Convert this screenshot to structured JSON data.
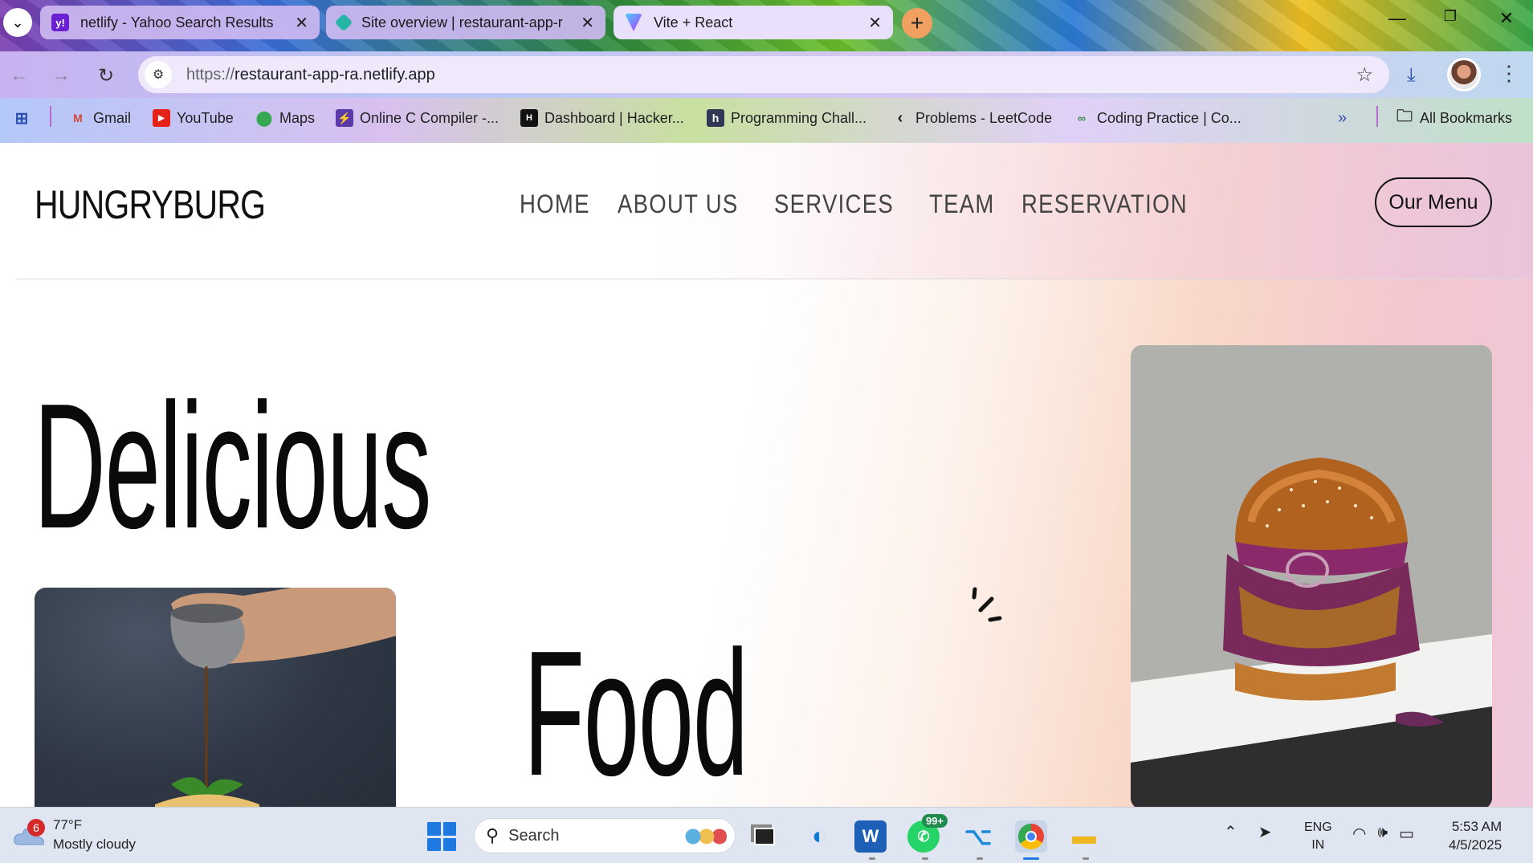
{
  "browser": {
    "tabs": [
      {
        "title": "netlify - Yahoo Search Results",
        "favicon": "yahoo-icon",
        "active": false
      },
      {
        "title": "Site overview | restaurant-app-r",
        "favicon": "netlify-icon",
        "active": false
      },
      {
        "title": "Vite + React",
        "favicon": "vite-icon",
        "active": true
      }
    ],
    "url_scheme": "https://",
    "url_host": "restaurant-app-ra.netlify.app",
    "bookmarks": [
      {
        "label": "Gmail",
        "icon": "gmail-icon"
      },
      {
        "label": "YouTube",
        "icon": "youtube-icon"
      },
      {
        "label": "Maps",
        "icon": "maps-icon"
      },
      {
        "label": "Online C Compiler -...",
        "icon": "compiler-icon"
      },
      {
        "label": "Dashboard | Hacker...",
        "icon": "hackerrank-icon"
      },
      {
        "label": "Programming Chall...",
        "icon": "hackerearth-icon"
      },
      {
        "label": "Problems - LeetCode",
        "icon": "leetcode-icon"
      },
      {
        "label": "Coding Practice | Co...",
        "icon": "gfg-icon"
      }
    ],
    "all_bookmarks_label": "All Bookmarks"
  },
  "site": {
    "brand": "HUNGRYBURG",
    "nav": [
      "HOME",
      "ABOUT US",
      "SERVICES",
      "TEAM",
      "RESERVATION"
    ],
    "menu_button": "Our Menu",
    "hero_word_1": "Delicious",
    "hero_word_2": "Food"
  },
  "taskbar": {
    "weather_badge": "6",
    "temperature": "77°F",
    "condition": "Mostly cloudy",
    "search_placeholder": "Search",
    "whatsapp_badge": "99+",
    "lang_line1": "ENG",
    "lang_line2": "IN",
    "time": "5:53 AM",
    "date": "4/5/2025"
  },
  "colors": {
    "nav_text": "#444444",
    "brand_text": "#111111",
    "page_gradient_end": "#eec8dc",
    "windows_blue": "#1e7ae0"
  }
}
